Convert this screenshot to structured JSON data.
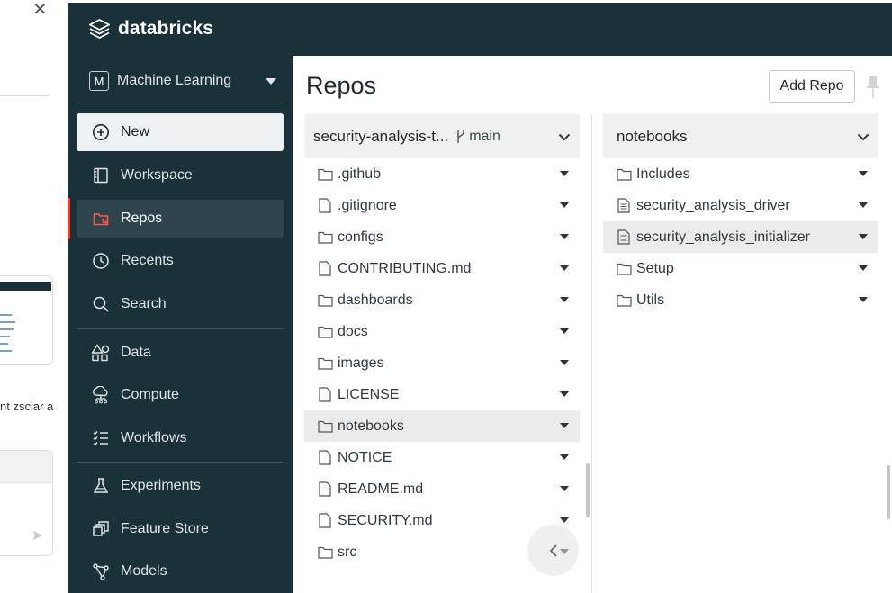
{
  "background": {
    "snippet_text": "nt zsclar a"
  },
  "brand": {
    "name": "databricks",
    "color": "#1b3139",
    "accent": "#ff3621"
  },
  "sidebar": {
    "persona": {
      "badge": "M",
      "label": "Machine Learning"
    },
    "new_label": "New",
    "items": [
      {
        "label": "Workspace",
        "icon": "workspace-icon"
      },
      {
        "label": "Repos",
        "icon": "repos-icon"
      },
      {
        "label": "Recents",
        "icon": "clock-icon"
      },
      {
        "label": "Search",
        "icon": "search-icon"
      },
      {
        "label": "Data",
        "icon": "data-icon"
      },
      {
        "label": "Compute",
        "icon": "compute-icon"
      },
      {
        "label": "Workflows",
        "icon": "workflows-icon"
      },
      {
        "label": "Experiments",
        "icon": "flask-icon"
      },
      {
        "label": "Feature Store",
        "icon": "feature-store-icon"
      },
      {
        "label": "Models",
        "icon": "models-icon"
      }
    ]
  },
  "main": {
    "title": "Repos",
    "add_repo_label": "Add Repo",
    "left_column": {
      "header": "security-analysis-t...",
      "branch": "main",
      "items": [
        {
          "name": ".github",
          "type": "folder"
        },
        {
          "name": ".gitignore",
          "type": "file"
        },
        {
          "name": "configs",
          "type": "folder"
        },
        {
          "name": "CONTRIBUTING.md",
          "type": "file"
        },
        {
          "name": "dashboards",
          "type": "folder"
        },
        {
          "name": "docs",
          "type": "folder"
        },
        {
          "name": "images",
          "type": "folder"
        },
        {
          "name": "LICENSE",
          "type": "file"
        },
        {
          "name": "notebooks",
          "type": "folder",
          "selected": true
        },
        {
          "name": "NOTICE",
          "type": "file"
        },
        {
          "name": "README.md",
          "type": "file"
        },
        {
          "name": "SECURITY.md",
          "type": "file"
        },
        {
          "name": "src",
          "type": "folder"
        }
      ]
    },
    "right_column": {
      "header": "notebooks",
      "items": [
        {
          "name": "Includes",
          "type": "folder"
        },
        {
          "name": "security_analysis_driver",
          "type": "notebook"
        },
        {
          "name": "security_analysis_initializer",
          "type": "notebook",
          "selected": true
        },
        {
          "name": "Setup",
          "type": "folder"
        },
        {
          "name": "Utils",
          "type": "folder"
        }
      ]
    }
  }
}
